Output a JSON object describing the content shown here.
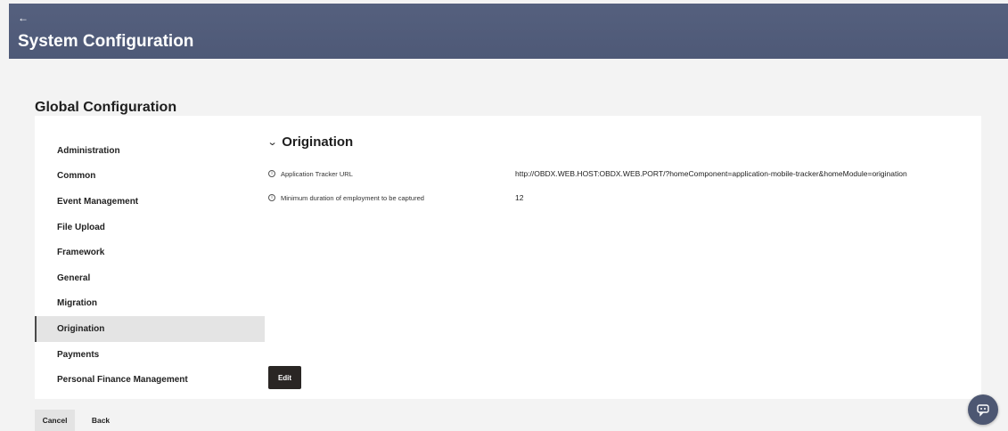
{
  "header": {
    "back_icon": "←",
    "title": "System Configuration"
  },
  "section": {
    "title": "Global Configuration"
  },
  "sidebar": {
    "items": [
      {
        "label": "Administration",
        "active": false
      },
      {
        "label": "Common",
        "active": false
      },
      {
        "label": "Event Management",
        "active": false
      },
      {
        "label": "File Upload",
        "active": false
      },
      {
        "label": "Framework",
        "active": false
      },
      {
        "label": "General",
        "active": false
      },
      {
        "label": "Migration",
        "active": false
      },
      {
        "label": "Origination",
        "active": true
      },
      {
        "label": "Payments",
        "active": false
      },
      {
        "label": "Personal Finance Management",
        "active": false
      }
    ]
  },
  "content": {
    "chevron": "⌄",
    "title": "Origination",
    "rows": [
      {
        "info": "i",
        "label": "Application Tracker URL",
        "value": "http://OBDX.WEB.HOST:OBDX.WEB.PORT/?homeComponent=application-mobile-tracker&homeModule=origination"
      },
      {
        "info": "i",
        "label": "Minimum duration of employment to be captured",
        "value": "12"
      }
    ],
    "edit_label": "Edit"
  },
  "footer": {
    "cancel_label": "Cancel",
    "back_label": "Back"
  },
  "icons": {
    "back": "back-arrow-icon",
    "chevron": "chevron-down-icon",
    "info": "info-icon",
    "chat": "chatbot-icon"
  },
  "colors": {
    "header_bg": "#55607e",
    "active_item_bg": "#e4e4e4",
    "edit_button_bg": "#2a2624",
    "fab_bg": "#4d5772"
  }
}
